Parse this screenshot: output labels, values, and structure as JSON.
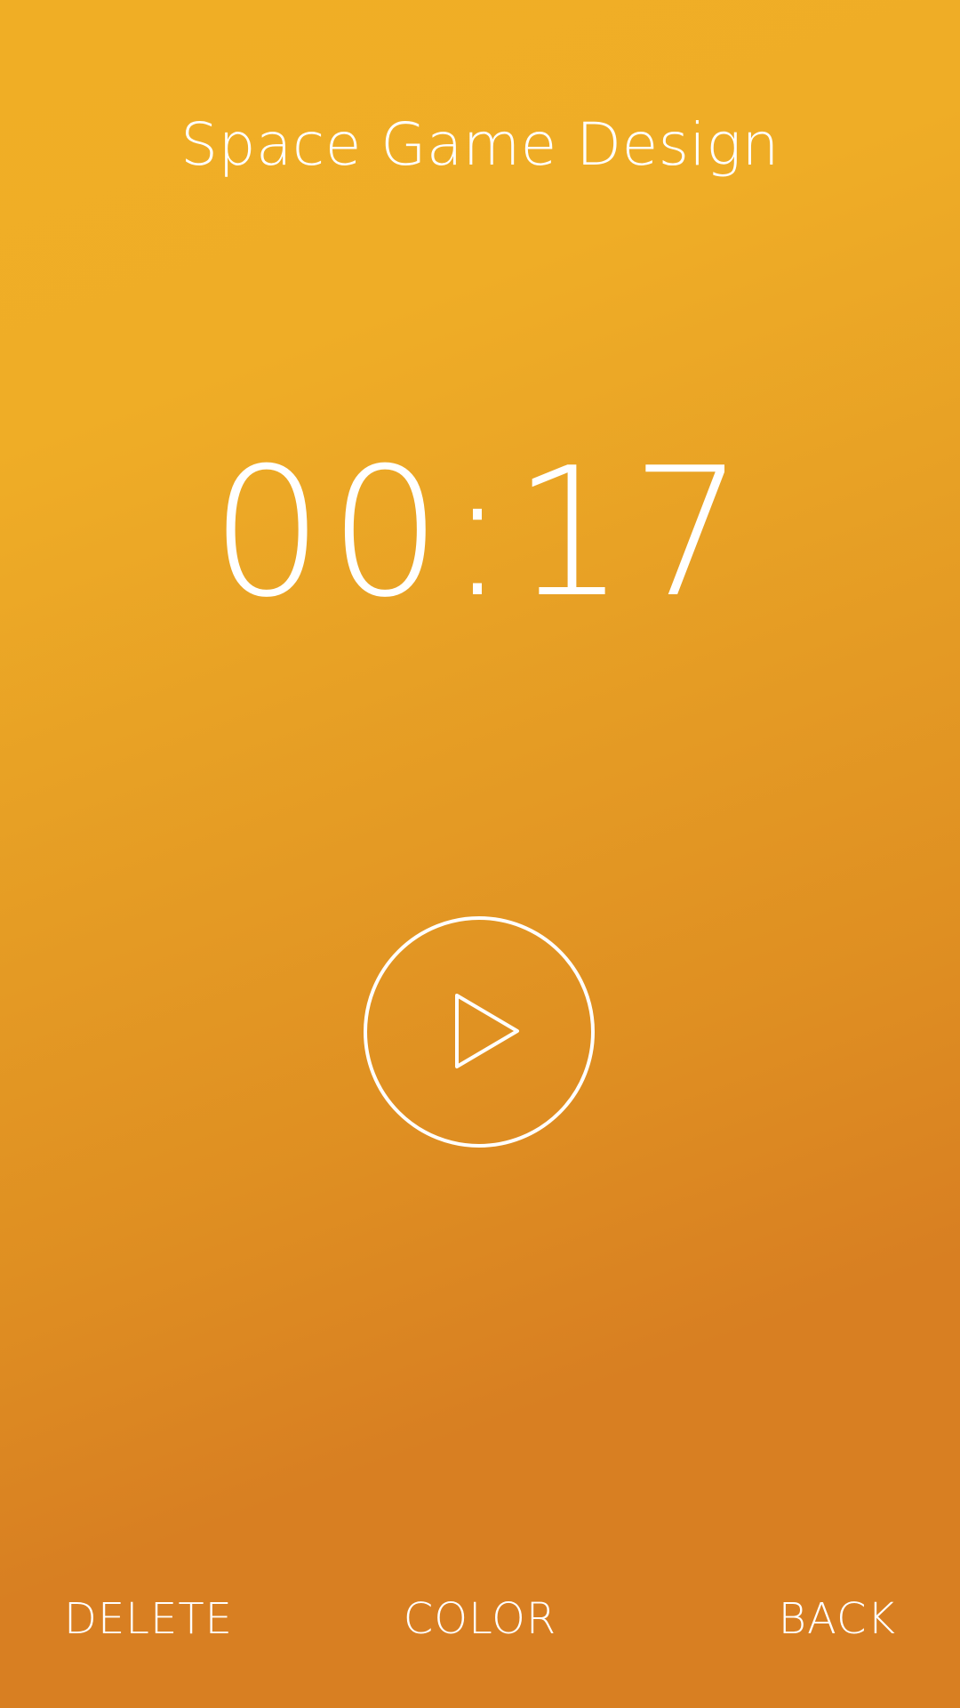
{
  "header": {
    "title": "Space Game Design"
  },
  "timer": {
    "display": "00:17"
  },
  "controls": {
    "play_icon": "play-icon"
  },
  "bottom_bar": {
    "delete_label": "DELETE",
    "color_label": "COLOR",
    "back_label": "BACK"
  },
  "colors": {
    "background_top": "#f0ae25",
    "background_bottom": "#d87f22",
    "foreground": "#ffffff"
  }
}
